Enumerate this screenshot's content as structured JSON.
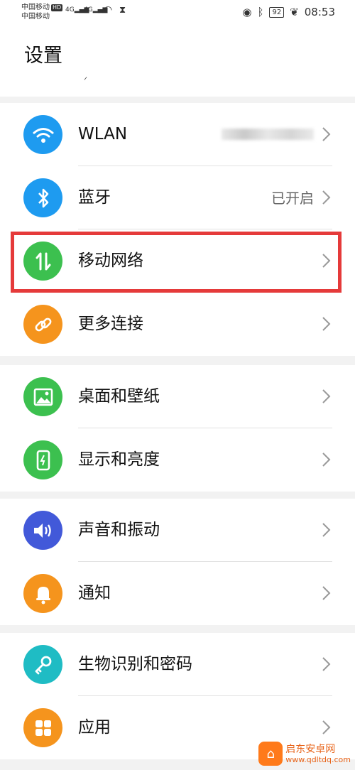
{
  "status": {
    "carrier1": "中国移动",
    "carrier2": "中国移动",
    "hd_badge": "HD",
    "net1": "4G",
    "net2": "4G",
    "battery": "92",
    "time": "08:53"
  },
  "header": {
    "title": "设置",
    "hint": "ᐟ"
  },
  "groups": [
    {
      "rows": [
        {
          "label": "WLAN",
          "value": "",
          "icon": "wifi-icon",
          "color": "#1e9bf0"
        },
        {
          "label": "蓝牙",
          "value": "已开启",
          "icon": "bluetooth-icon",
          "color": "#1e9bf0"
        },
        {
          "label": "移动网络",
          "value": "",
          "icon": "mobile-data-icon",
          "color": "#3cc04f"
        },
        {
          "label": "更多连接",
          "value": "",
          "icon": "link-icon",
          "color": "#f5941d"
        }
      ]
    },
    {
      "rows": [
        {
          "label": "桌面和壁纸",
          "icon": "wallpaper-icon",
          "color": "#3cc04f"
        },
        {
          "label": "显示和亮度",
          "icon": "display-icon",
          "color": "#3cc04f"
        }
      ]
    },
    {
      "rows": [
        {
          "label": "声音和振动",
          "icon": "sound-icon",
          "color": "#4259d9"
        },
        {
          "label": "通知",
          "icon": "bell-icon",
          "color": "#f5941d"
        }
      ]
    },
    {
      "rows": [
        {
          "label": "生物识别和密码",
          "icon": "key-icon",
          "color": "#1fbcc4"
        },
        {
          "label": "应用",
          "icon": "apps-icon",
          "color": "#f5941d"
        }
      ]
    }
  ],
  "watermark": {
    "name": "启东安卓网",
    "url": "www.qdltdq.com"
  },
  "colors": {
    "highlight": "#e53a3a"
  }
}
